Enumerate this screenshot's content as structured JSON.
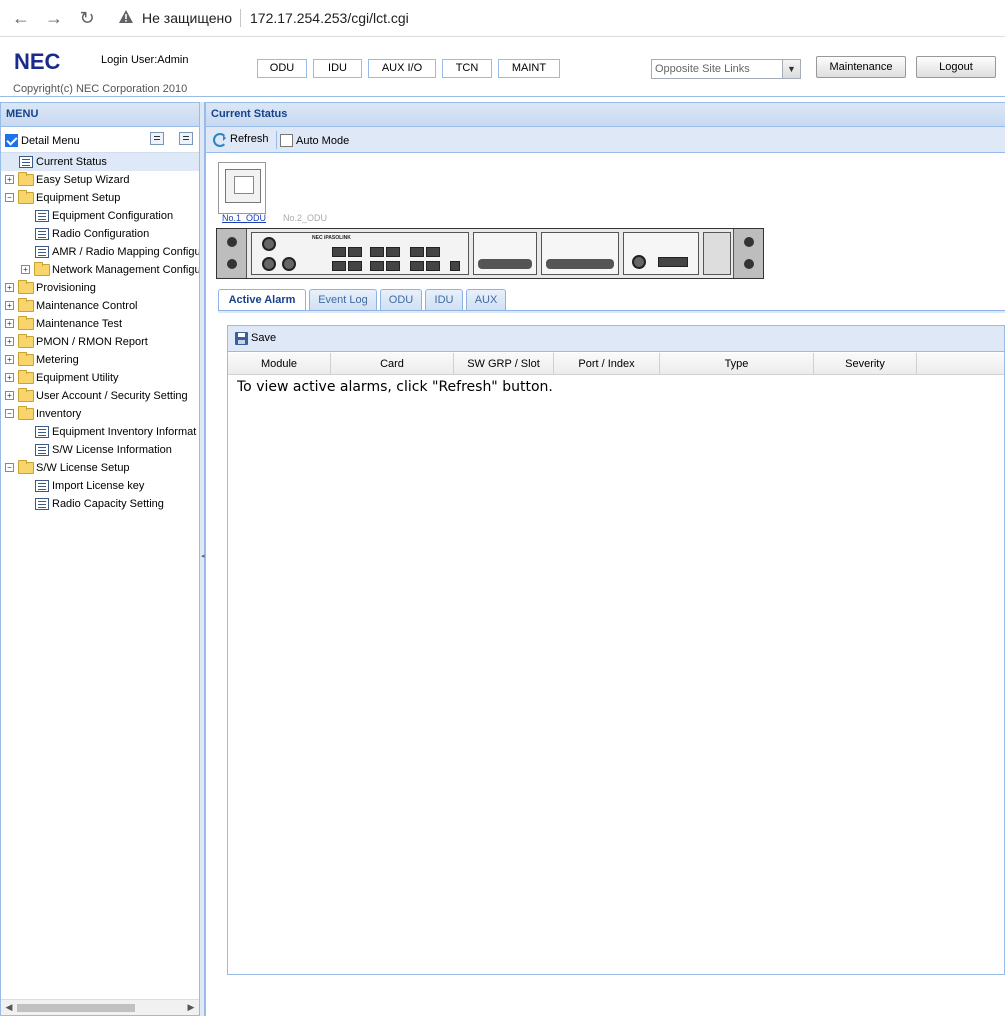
{
  "browser": {
    "insecure_label": "Не защищено",
    "url": "172.17.254.253/cgi/lct.cgi"
  },
  "header": {
    "logo": "NEC",
    "login_user": "Login User:Admin",
    "copyright": "Copyright(c) NEC Corporation 2010",
    "nav_buttons": [
      "ODU",
      "IDU",
      "AUX I/O",
      "TCN",
      "MAINT"
    ],
    "site_links_value": "Opposite Site Links",
    "maintenance_label": "Maintenance",
    "logout_label": "Logout"
  },
  "menu": {
    "title": "MENU",
    "detail_menu_label": "Detail Menu",
    "detail_menu_checked": true,
    "items": [
      {
        "label": "Current Status",
        "type": "leaf",
        "level": 0,
        "selected": true
      },
      {
        "label": "Easy Setup Wizard",
        "type": "folder",
        "level": 0,
        "expander": "+"
      },
      {
        "label": "Equipment Setup",
        "type": "folder",
        "level": 0,
        "expander": "−"
      },
      {
        "label": "Equipment Configuration",
        "type": "leaf",
        "level": 1
      },
      {
        "label": "Radio Configuration",
        "type": "leaf",
        "level": 1
      },
      {
        "label": "AMR / Radio Mapping Configur",
        "type": "leaf",
        "level": 1
      },
      {
        "label": "Network Management Configu",
        "type": "folder",
        "level": 1,
        "expander": "+"
      },
      {
        "label": "Provisioning",
        "type": "folder",
        "level": 0,
        "expander": "+"
      },
      {
        "label": "Maintenance Control",
        "type": "folder",
        "level": 0,
        "expander": "+"
      },
      {
        "label": "Maintenance Test",
        "type": "folder",
        "level": 0,
        "expander": "+"
      },
      {
        "label": "PMON / RMON Report",
        "type": "folder",
        "level": 0,
        "expander": "+"
      },
      {
        "label": "Metering",
        "type": "folder",
        "level": 0,
        "expander": "+"
      },
      {
        "label": "Equipment Utility",
        "type": "folder",
        "level": 0,
        "expander": "+"
      },
      {
        "label": "User Account / Security Setting",
        "type": "folder",
        "level": 0,
        "expander": "+"
      },
      {
        "label": "Inventory",
        "type": "folder",
        "level": 0,
        "expander": "−"
      },
      {
        "label": "Equipment Inventory Informat",
        "type": "leaf",
        "level": 1
      },
      {
        "label": "S/W License Information",
        "type": "leaf",
        "level": 1
      },
      {
        "label": "S/W License Setup",
        "type": "folder",
        "level": 0,
        "expander": "−"
      },
      {
        "label": "Import License key",
        "type": "leaf",
        "level": 1
      },
      {
        "label": "Radio Capacity Setting",
        "type": "leaf",
        "level": 1
      }
    ]
  },
  "main": {
    "title": "Current Status",
    "refresh_label": "Refresh",
    "auto_mode_label": "Auto Mode",
    "odu_links": [
      "No.1_ODU",
      "No.2_ODU"
    ],
    "tabs": [
      {
        "label": "Active Alarm",
        "active": true
      },
      {
        "label": "Event Log",
        "active": false
      },
      {
        "label": "ODU",
        "active": false
      },
      {
        "label": "IDU",
        "active": false
      },
      {
        "label": "AUX",
        "active": false
      }
    ],
    "save_label": "Save",
    "columns": [
      "Module",
      "Card",
      "SW GRP / Slot",
      "Port / Index",
      "Type",
      "Severity"
    ],
    "empty_message": "To view active alarms, click \"Refresh\" button."
  }
}
